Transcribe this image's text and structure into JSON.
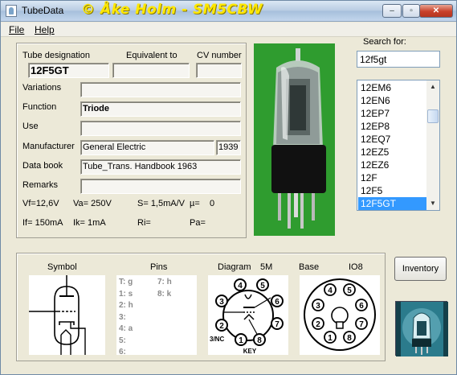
{
  "window": {
    "title": "TubeData",
    "copyright": "© Åke Holm - SM5CBW",
    "min": "–",
    "max": "▫",
    "close": "✕"
  },
  "menu": [
    {
      "label": "File"
    },
    {
      "label": "Help"
    }
  ],
  "header": {
    "designation_label": "Tube designation",
    "equivalent_label": "Equivalent to",
    "cv_label": "CV number",
    "designation": "12F5GT",
    "equivalent": "",
    "cv": ""
  },
  "fields": {
    "variations_label": "Variations",
    "variations": "",
    "function_label": "Function",
    "function": "Triode",
    "use_label": "Use",
    "use": "",
    "manufacturer_label": "Manufacturer",
    "manufacturer": "General Electric",
    "year": "1939",
    "databook_label": "Data book",
    "databook": "Tube_Trans. Handbook 1963",
    "remarks_label": "Remarks",
    "remarks": ""
  },
  "specs": {
    "vf": "Vf=12,6V",
    "va": "Va= 250V",
    "s": "S= 1,5mA/V",
    "mu": "µ=",
    "mu_val": "0",
    "if": "If= 150mA",
    "ik": "Ik= 1mA",
    "ri": "Ri=",
    "pa": "Pa="
  },
  "search": {
    "label": "Search for:",
    "value": "12f5gt"
  },
  "list": {
    "items": [
      "12EM6",
      "12EN6",
      "12EP7",
      "12EP8",
      "12EQ7",
      "12EZ5",
      "12EZ6",
      "12F",
      "12F5",
      "12F5GT"
    ],
    "selected": "12F5GT"
  },
  "bottom": {
    "symbol_label": "Symbol",
    "pins_label": "Pins",
    "diagram_label": "Diagram",
    "diagram_code": "5M",
    "base_label": "Base",
    "base_code": "IO8"
  },
  "pins": {
    "col1": [
      "T: g",
      "1: s",
      "2: h",
      "3:",
      "4: a",
      "5:",
      "6:"
    ],
    "col2": [
      "7: h",
      "8: k"
    ]
  },
  "diagram": {
    "pin_numbers": [
      "1",
      "2",
      "3",
      "4",
      "5",
      "6",
      "7",
      "8"
    ],
    "left_note": "3/NC",
    "key": "KEY"
  },
  "base": {
    "pin_numbers": [
      "1",
      "2",
      "3",
      "4",
      "5",
      "6",
      "7",
      "8"
    ]
  },
  "inventory_label": "Inventory"
}
